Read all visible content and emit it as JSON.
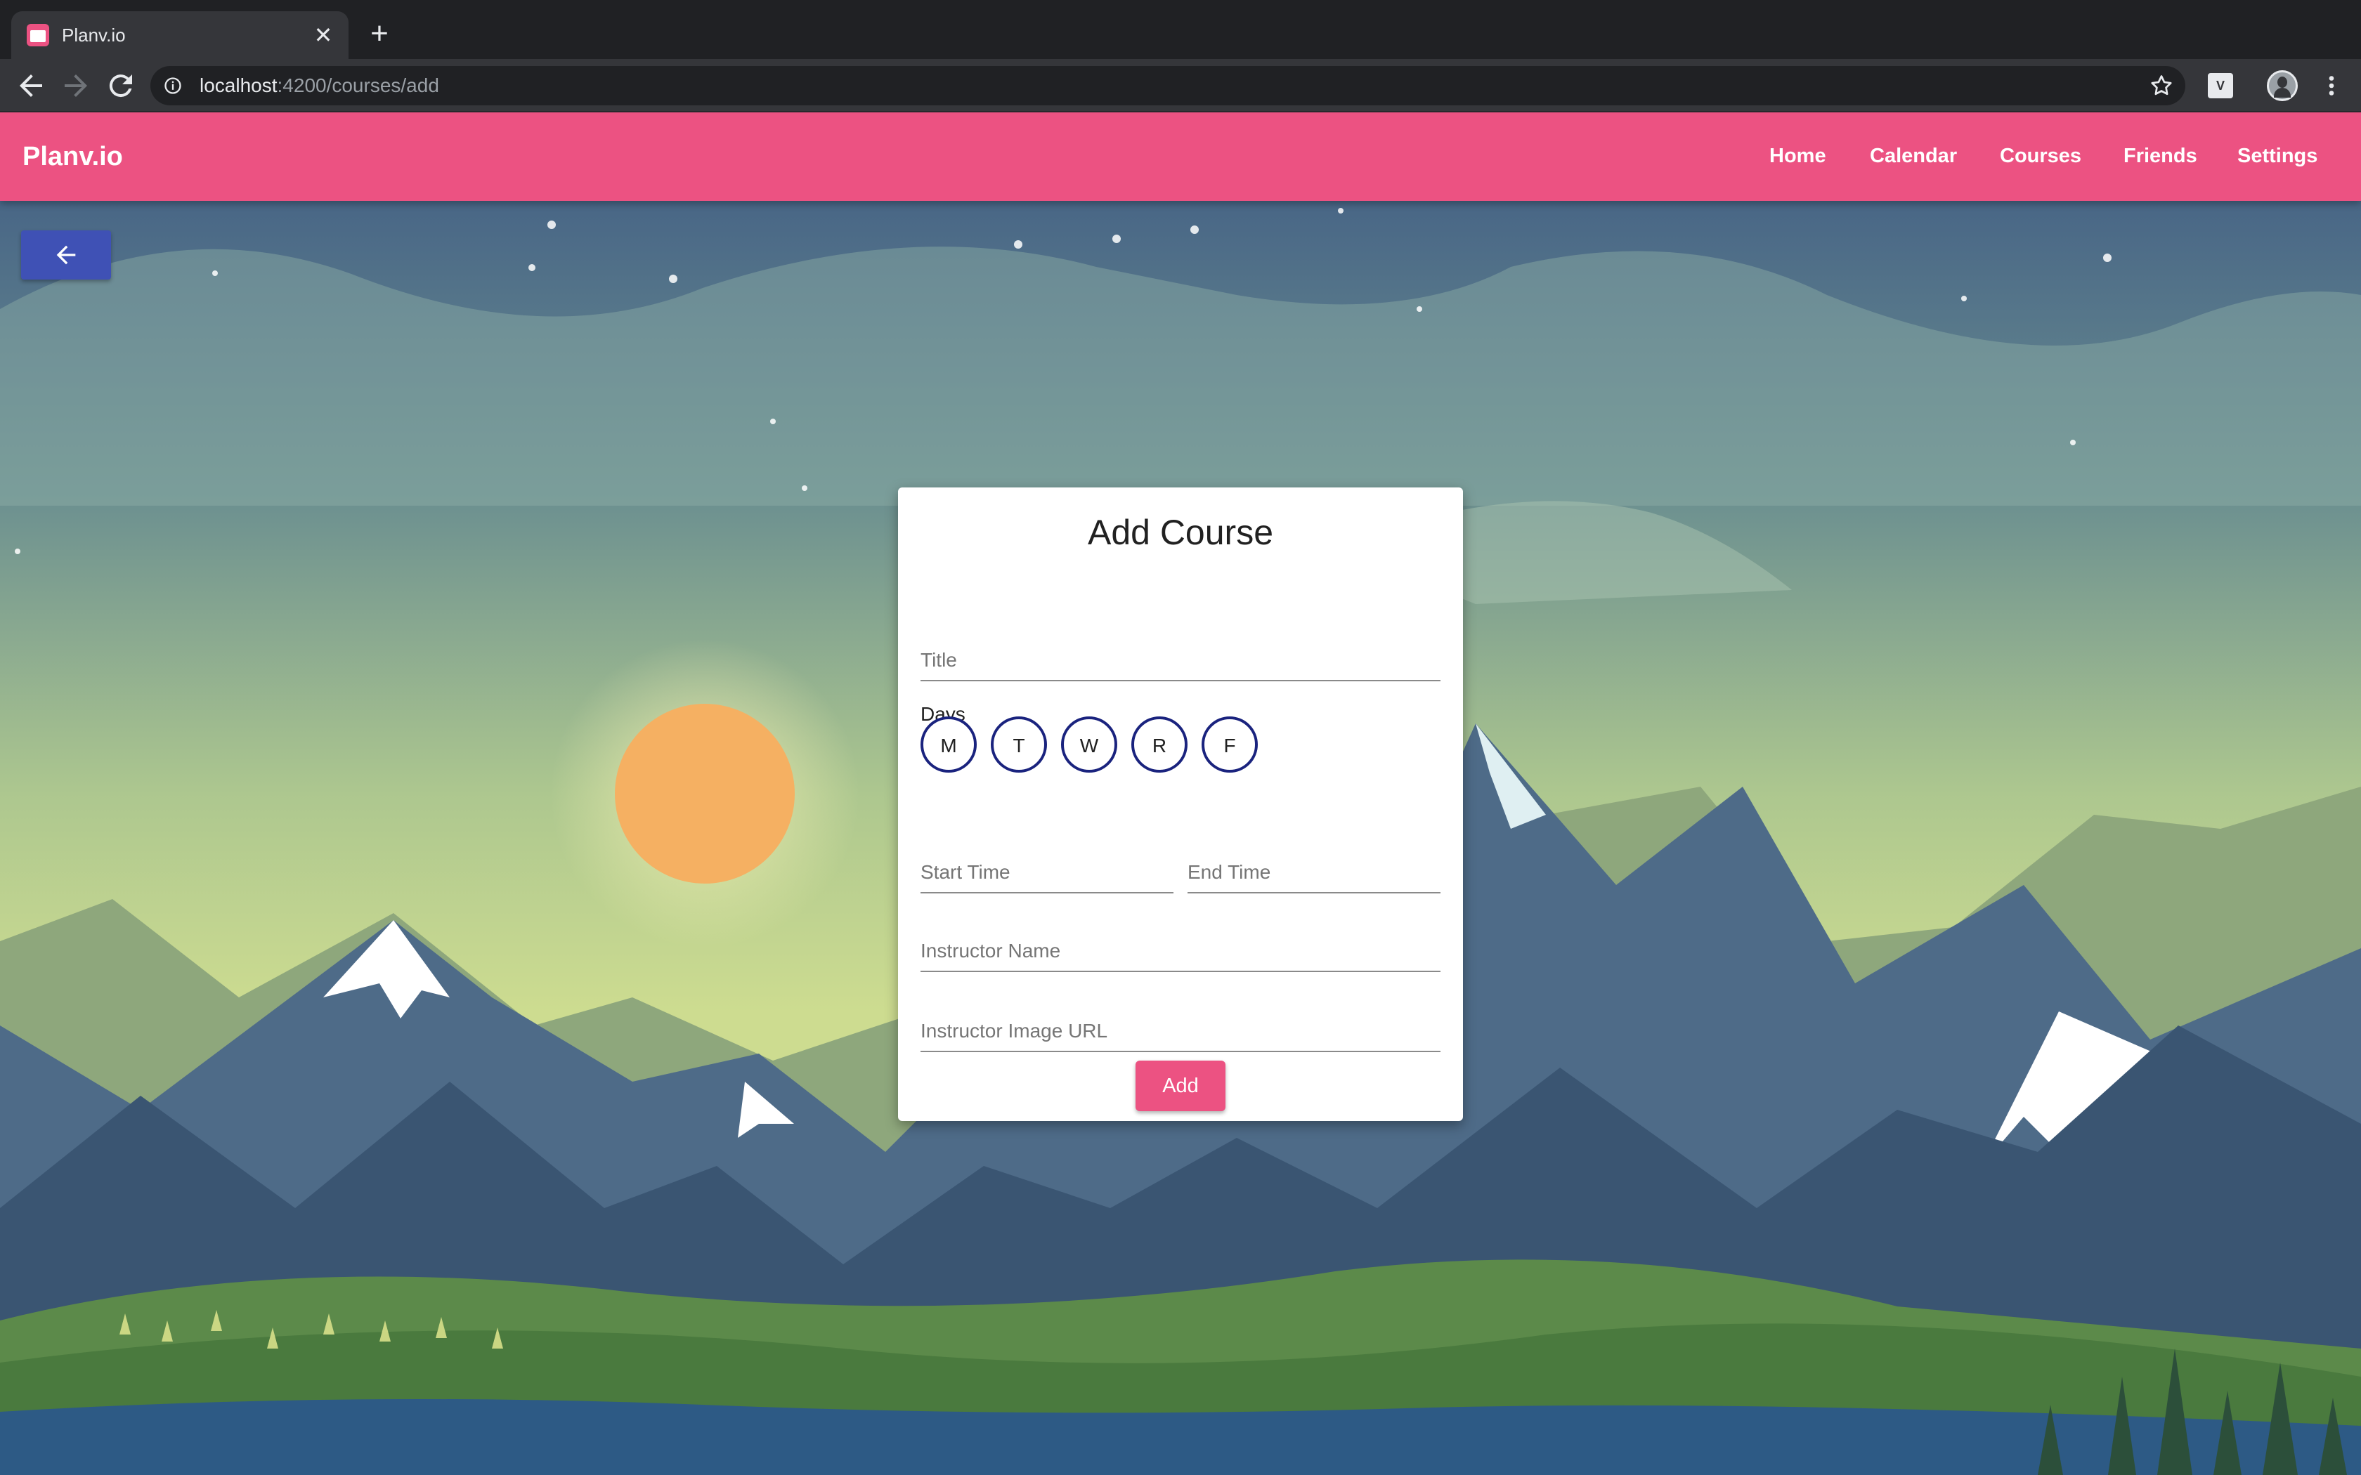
{
  "browser": {
    "tab_title": "Planv.io",
    "tab_close": "✕",
    "new_tab": "+",
    "url_host": "localhost",
    "url_path": ":4200/courses/add",
    "ext_label": "V"
  },
  "app": {
    "brand": "Planv.io",
    "nav": [
      "Home",
      "Calendar",
      "Courses",
      "Friends",
      "Settings"
    ],
    "colors": {
      "accent": "#ec5282",
      "primary": "#3f51b5",
      "day_border": "#1a237e"
    }
  },
  "form": {
    "title": "Add Course",
    "title_placeholder": "Title",
    "days_label": "Days",
    "days": [
      "M",
      "T",
      "W",
      "R",
      "F"
    ],
    "start_time_placeholder": "Start Time",
    "end_time_placeholder": "End Time",
    "instructor_name_placeholder": "Instructor Name",
    "instructor_image_placeholder": "Instructor Image URL",
    "submit_label": "Add"
  },
  "icons": {
    "back_button": "arrow-left-icon",
    "toolbar": [
      "back-icon",
      "forward-icon",
      "reload-icon",
      "info-icon",
      "star-icon",
      "menu-icon"
    ]
  }
}
